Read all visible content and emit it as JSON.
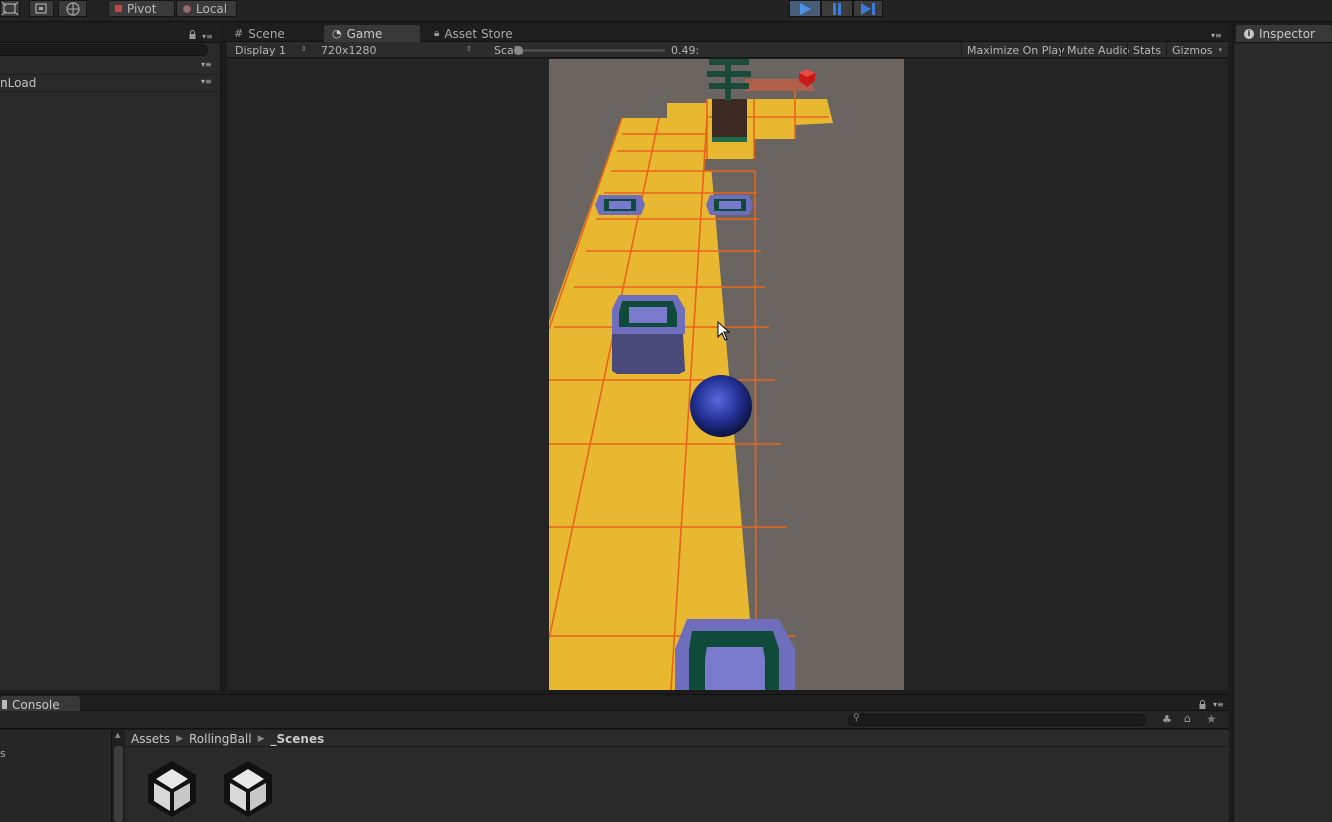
{
  "toolbar": {
    "pivot_label": "Pivot",
    "local_label": "Local"
  },
  "hierarchy": {
    "row_label": "nLoad"
  },
  "tabs": {
    "scene": "Scene",
    "game": "Game",
    "asset_store": "Asset Store",
    "inspector": "Inspector",
    "console": "Console"
  },
  "game_toolbar": {
    "display": "Display 1",
    "resolution": "720x1280",
    "scale_label": "Scale",
    "scale_value": "0.49:",
    "scale_fraction": 0.0,
    "maximize": "Maximize On Play",
    "mute": "Mute Audio",
    "stats": "Stats",
    "gizmos": "Gizmos"
  },
  "project": {
    "breadcrumb": [
      "Assets",
      "RollingBall",
      "_Scenes"
    ],
    "left_label": "s",
    "assets": [
      {
        "icon": "unity-scene-icon"
      },
      {
        "icon": "unity-scene-icon"
      }
    ]
  },
  "colors": {
    "play_active": "#4a7fd4",
    "track_yellow": "#e8b830",
    "track_lines": "#e8641c",
    "obstacle_blue": "#6e6ebc",
    "obstacle_green": "#0f4a3a",
    "ball_blue": "#1f2a8a",
    "gem_red": "#c81818"
  }
}
